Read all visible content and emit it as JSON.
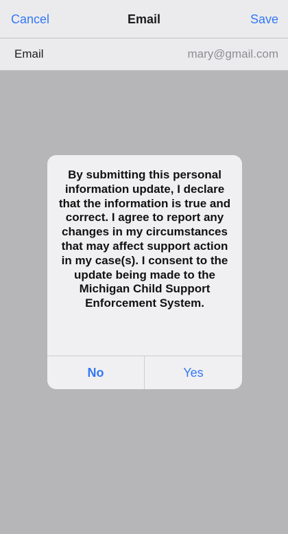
{
  "nav": {
    "cancel_label": "Cancel",
    "title": "Email",
    "save_label": "Save"
  },
  "email_row": {
    "label": "Email",
    "value": "mary@gmail.com"
  },
  "dialog": {
    "message": "By submitting this personal information update, I declare that the information is true and correct. I agree to report any changes in my circumstances that may affect support action in my case(s). I consent to the update being made to the Michigan Child Support Enforcement System.",
    "no_label": "No",
    "yes_label": "Yes"
  },
  "colors": {
    "accent": "#3478f6",
    "overlay": "#b6b6b8",
    "dialog_bg": "#f0f0f2"
  }
}
